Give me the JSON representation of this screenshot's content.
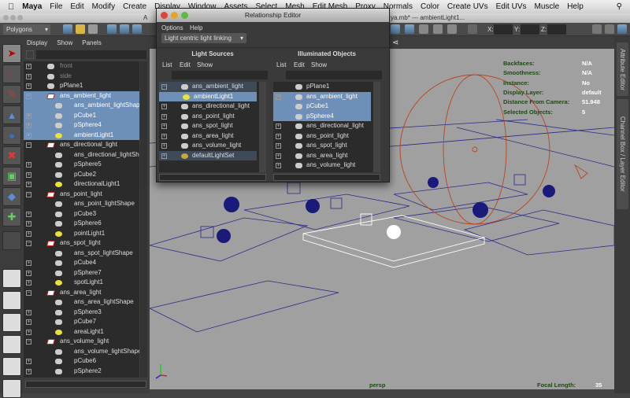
{
  "menubar": {
    "app": "Maya",
    "items": [
      "File",
      "Edit",
      "Modify",
      "Create",
      "Display",
      "Window",
      "Assets",
      "Select",
      "Mesh",
      "Edit Mesh",
      "Proxy",
      "Normals",
      "Color",
      "Create UVs",
      "Edit UVs",
      "Muscle",
      "Help"
    ]
  },
  "window": {
    "title_left": "A",
    "title_right": "ya.mb*  ---  ambientLight1..."
  },
  "toolbar": {
    "menuset": "Polygons",
    "x_label": "X:",
    "y_label": "Y:",
    "z_label": "Z:"
  },
  "outliner": {
    "menus": [
      "Display",
      "Show",
      "Panels"
    ],
    "rows": [
      {
        "label": "front",
        "exp": "+",
        "icon": "cam",
        "lvl": 0,
        "dim": true
      },
      {
        "label": "side",
        "exp": "+",
        "icon": "cam",
        "lvl": 0,
        "dim": true
      },
      {
        "label": "pPlane1",
        "exp": "+",
        "icon": "mesh",
        "lvl": 0
      },
      {
        "label": "ans_ambient_light",
        "exp": "-",
        "icon": "set",
        "lvl": 0,
        "sel": true
      },
      {
        "label": "ans_ambient_lightShape",
        "exp": "",
        "icon": "mesh",
        "lvl": 1,
        "sel": true
      },
      {
        "label": "pCube1",
        "exp": "+",
        "icon": "mesh",
        "lvl": 1,
        "sel": true
      },
      {
        "label": "pSphere4",
        "exp": "+",
        "icon": "mesh",
        "lvl": 1,
        "sel": true
      },
      {
        "label": "ambientLight1",
        "exp": "+",
        "icon": "light",
        "lvl": 1,
        "sel": true
      },
      {
        "label": "ans_directional_light",
        "exp": "-",
        "icon": "set",
        "lvl": 0
      },
      {
        "label": "ans_directional_lightShape",
        "exp": "",
        "icon": "mesh",
        "lvl": 1
      },
      {
        "label": "pSphere5",
        "exp": "+",
        "icon": "mesh",
        "lvl": 1
      },
      {
        "label": "pCube2",
        "exp": "+",
        "icon": "mesh",
        "lvl": 1
      },
      {
        "label": "directionalLight1",
        "exp": "+",
        "icon": "light",
        "lvl": 1
      },
      {
        "label": "ans_point_light",
        "exp": "-",
        "icon": "set",
        "lvl": 0
      },
      {
        "label": "ans_point_lightShape",
        "exp": "",
        "icon": "mesh",
        "lvl": 1
      },
      {
        "label": "pCube3",
        "exp": "+",
        "icon": "mesh",
        "lvl": 1
      },
      {
        "label": "pSphere6",
        "exp": "+",
        "icon": "mesh",
        "lvl": 1
      },
      {
        "label": "pointLight1",
        "exp": "+",
        "icon": "light",
        "lvl": 1
      },
      {
        "label": "ans_spot_light",
        "exp": "-",
        "icon": "set",
        "lvl": 0
      },
      {
        "label": "ans_spot_lightShape",
        "exp": "",
        "icon": "mesh",
        "lvl": 1
      },
      {
        "label": "pCube4",
        "exp": "+",
        "icon": "mesh",
        "lvl": 1
      },
      {
        "label": "pSphere7",
        "exp": "+",
        "icon": "mesh",
        "lvl": 1
      },
      {
        "label": "spotLight1",
        "exp": "+",
        "icon": "light",
        "lvl": 1
      },
      {
        "label": "ans_area_light",
        "exp": "-",
        "icon": "set",
        "lvl": 0
      },
      {
        "label": "ans_area_lightShape",
        "exp": "",
        "icon": "mesh",
        "lvl": 1
      },
      {
        "label": "pSphere3",
        "exp": "+",
        "icon": "mesh",
        "lvl": 1
      },
      {
        "label": "pCube7",
        "exp": "+",
        "icon": "mesh",
        "lvl": 1
      },
      {
        "label": "areaLight1",
        "exp": "+",
        "icon": "light",
        "lvl": 1
      },
      {
        "label": "ans_volume_light",
        "exp": "-",
        "icon": "set",
        "lvl": 0
      },
      {
        "label": "ans_volume_lightShape",
        "exp": "",
        "icon": "mesh",
        "lvl": 1
      },
      {
        "label": "pCube6",
        "exp": "+",
        "icon": "mesh",
        "lvl": 1
      },
      {
        "label": "pSphere2",
        "exp": "+",
        "icon": "mesh",
        "lvl": 1
      }
    ]
  },
  "relationship_editor": {
    "title": "Relationship Editor",
    "menus": [
      "Options",
      "Help"
    ],
    "mode": "Light centric light linking",
    "left": {
      "header": "Light Sources",
      "menus": [
        "List",
        "Edit",
        "Show"
      ],
      "rows": [
        {
          "label": "ans_ambient_light",
          "exp": "-",
          "icon": "mesh",
          "lvl": 0,
          "set": true
        },
        {
          "label": "ambientLight1",
          "exp": "",
          "icon": "light",
          "lvl": 1,
          "sel": true
        },
        {
          "label": "ans_directional_light",
          "exp": "+",
          "icon": "mesh",
          "lvl": 0
        },
        {
          "label": "ans_point_light",
          "exp": "+",
          "icon": "mesh",
          "lvl": 0
        },
        {
          "label": "ans_spot_light",
          "exp": "+",
          "icon": "mesh",
          "lvl": 0
        },
        {
          "label": "ans_area_light",
          "exp": "+",
          "icon": "mesh",
          "lvl": 0
        },
        {
          "label": "ans_volume_light",
          "exp": "+",
          "icon": "mesh",
          "lvl": 0
        },
        {
          "label": "defaultLightSet",
          "exp": "+",
          "icon": "setball",
          "lvl": 0,
          "set": true
        }
      ]
    },
    "right": {
      "header": "Illuminated Objects",
      "menus": [
        "List",
        "Edit",
        "Show"
      ],
      "rows": [
        {
          "label": "pPlane1",
          "exp": "",
          "icon": "mesh",
          "lvl": 0
        },
        {
          "label": "ans_ambient_light",
          "exp": "-",
          "icon": "mesh",
          "lvl": 0,
          "sel": true
        },
        {
          "label": "pCube1",
          "exp": "",
          "icon": "mesh",
          "lvl": 1,
          "sel": true
        },
        {
          "label": "pSphere4",
          "exp": "",
          "icon": "mesh",
          "lvl": 1,
          "sel": true
        },
        {
          "label": "ans_directional_light",
          "exp": "+",
          "icon": "mesh",
          "lvl": 0
        },
        {
          "label": "ans_point_light",
          "exp": "+",
          "icon": "mesh",
          "lvl": 0
        },
        {
          "label": "ans_spot_light",
          "exp": "+",
          "icon": "mesh",
          "lvl": 0
        },
        {
          "label": "ans_area_light",
          "exp": "+",
          "icon": "mesh",
          "lvl": 0
        },
        {
          "label": "ans_volume_light",
          "exp": "+",
          "icon": "mesh",
          "lvl": 0
        }
      ]
    }
  },
  "viewport": {
    "hud": [
      {
        "k": "Backfaces:",
        "v": "N/A"
      },
      {
        "k": "Smoothness:",
        "v": "N/A"
      },
      {
        "k": "Instance:",
        "v": "No"
      },
      {
        "k": "Display Layer:",
        "v": "default"
      },
      {
        "k": "Distance From Camera:",
        "v": "51.948"
      },
      {
        "k": "Selected Objects:",
        "v": "5"
      }
    ],
    "camera": "persp",
    "focal_label": "Focal Length:",
    "focal_value": "35"
  },
  "dock": {
    "tabs": [
      "Attribute Editor",
      "Channel Box / Layer Editor"
    ]
  }
}
